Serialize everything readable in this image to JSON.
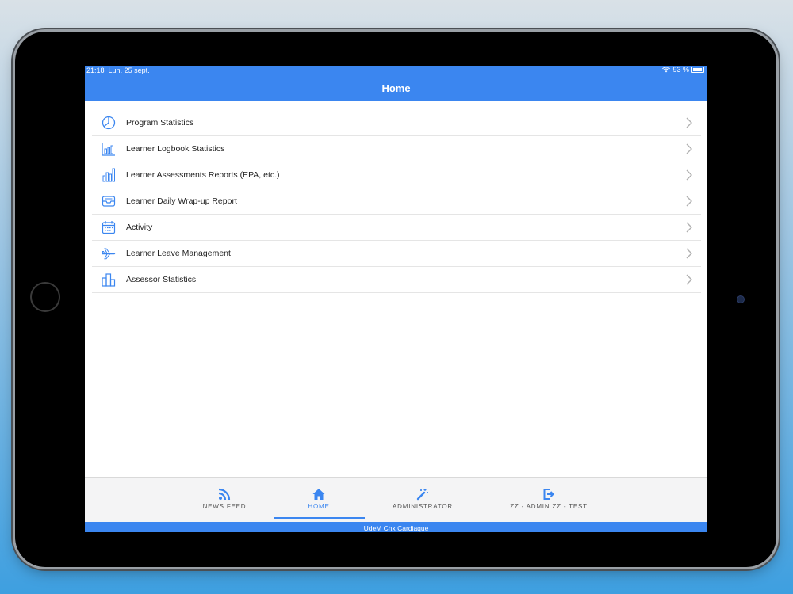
{
  "status": {
    "time": "21:18",
    "date": "Lun. 25 sept.",
    "battery": "93 %"
  },
  "nav": {
    "title": "Home"
  },
  "menu": [
    {
      "label": "Program Statistics",
      "icon": "pie-chart-icon"
    },
    {
      "label": "Learner Logbook Statistics",
      "icon": "bar-chart-icon"
    },
    {
      "label": "Learner Assessments Reports (EPA, etc.)",
      "icon": "vertical-bars-icon"
    },
    {
      "label": "Learner Daily Wrap-up Report",
      "icon": "inbox-tray-icon"
    },
    {
      "label": "Activity",
      "icon": "calendar-icon"
    },
    {
      "label": "Learner Leave Management",
      "icon": "airplane-icon"
    },
    {
      "label": "Assessor Statistics",
      "icon": "podium-bars-icon"
    }
  ],
  "tabs": [
    {
      "label": "NEWS FEED",
      "icon": "rss-icon"
    },
    {
      "label": "HOME",
      "icon": "house-icon",
      "active": true
    },
    {
      "label": "ADMINISTRATOR",
      "icon": "magic-wand-icon"
    },
    {
      "label": "ZZ - ADMIN ZZ - TEST",
      "icon": "sign-out-icon"
    }
  ],
  "footer": {
    "text": "UdeM Chx Cardiaque"
  },
  "colors": {
    "accent": "#3b86f0",
    "text": "#222222",
    "divider": "#e5e5e5"
  }
}
